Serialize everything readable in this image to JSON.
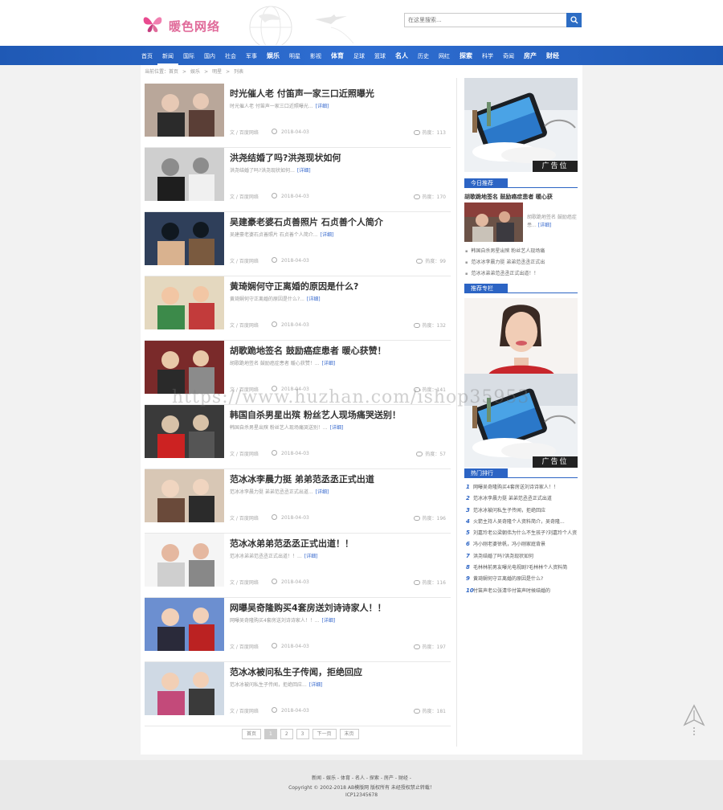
{
  "header": {
    "brand": "暖色网络",
    "search_placeholder": "在这里搜索..."
  },
  "nav": [
    {
      "label": "首页",
      "active": false,
      "big": false
    },
    {
      "label": "新闻",
      "active": true,
      "big": false
    },
    {
      "label": "国际",
      "active": false,
      "big": false
    },
    {
      "label": "国内",
      "active": false,
      "big": false
    },
    {
      "label": "社会",
      "active": false,
      "big": false
    },
    {
      "label": "军事",
      "active": false,
      "big": false
    },
    {
      "label": "娱乐",
      "active": false,
      "big": true
    },
    {
      "label": "明星",
      "active": false,
      "big": false
    },
    {
      "label": "影视",
      "active": false,
      "big": false
    },
    {
      "label": "体育",
      "active": false,
      "big": true
    },
    {
      "label": "足球",
      "active": false,
      "big": false
    },
    {
      "label": "篮球",
      "active": false,
      "big": false
    },
    {
      "label": "名人",
      "active": false,
      "big": true
    },
    {
      "label": "历史",
      "active": false,
      "big": false
    },
    {
      "label": "网红",
      "active": false,
      "big": false
    },
    {
      "label": "探索",
      "active": false,
      "big": true
    },
    {
      "label": "科学",
      "active": false,
      "big": false
    },
    {
      "label": "奇闻",
      "active": false,
      "big": false
    },
    {
      "label": "房产",
      "active": false,
      "big": true
    },
    {
      "label": "财经",
      "active": false,
      "big": true
    }
  ],
  "breadcrumb": {
    "prefix": "当前位置：首页",
    "items": [
      "娱乐",
      "明星",
      "列表"
    ]
  },
  "articles": [
    {
      "title": "时光催人老 付笛声一家三口近照曝光",
      "summary": "时光催人老 付笛声一家三口近照曝光...",
      "more": "[详细]",
      "source": "文 / 百度网络",
      "date": "2018-04-03",
      "hot": "热度：113"
    },
    {
      "title": "洪尧结婚了吗?洪尧现状如何",
      "summary": "洪尧结婚了吗?洪尧现状如何...",
      "more": "[详细]",
      "source": "文 / 百度网络",
      "date": "2018-04-03",
      "hot": "热度：170"
    },
    {
      "title": "吴建豪老婆石贞善照片 石贞善个人简介",
      "summary": "吴建豪老婆石贞善照片 石贞善个人简介...",
      "more": "[详细]",
      "source": "文 / 百度网络",
      "date": "2018-04-03",
      "hot": "热度：99"
    },
    {
      "title": "黄琦娴何守正离婚的原因是什么?",
      "summary": "黄琦娴何守正离婚的原因是什么?...",
      "more": "[详细]",
      "source": "文 / 百度网络",
      "date": "2018-04-03",
      "hot": "热度：132"
    },
    {
      "title": "胡歌跪地签名 鼓励癌症患者 暖心获赞！",
      "summary": "胡歌跪地签名 鼓励癌症患者 暖心获赞！...",
      "more": "[详细]",
      "source": "文 / 百度网络",
      "date": "2018-04-03",
      "hot": "热度：141"
    },
    {
      "title": "韩国自杀男星出殡 粉丝艺人现场痛哭送别！",
      "summary": "韩国自杀男星出殡 粉丝艺人现场痛哭送别！...",
      "more": "[详细]",
      "source": "文 / 百度网络",
      "date": "2018-04-03",
      "hot": "热度：57"
    },
    {
      "title": "范冰冰李晨力挺 弟弟范丞丞正式出道",
      "summary": "范冰冰李晨力挺 弟弟范丞丞正式出道...",
      "more": "[详细]",
      "source": "文 / 百度网络",
      "date": "2018-04-03",
      "hot": "热度：196"
    },
    {
      "title": "范冰冰弟弟范丞丞正式出道！！",
      "summary": "范冰冰弟弟范丞丞正式出道！！...",
      "more": "[详细]",
      "source": "文 / 百度网络",
      "date": "2018-04-03",
      "hot": "热度：116"
    },
    {
      "title": "网曝吴奇隆购买4套房送刘诗诗家人！！",
      "summary": "网曝吴奇隆购买4套房送刘诗诗家人！！...",
      "more": "[详细]",
      "source": "文 / 百度网络",
      "date": "2018-04-03",
      "hot": "热度：197"
    },
    {
      "title": "范冰冰被问私生子传闻，拒绝回应",
      "summary": "范冰冰被问私生子传闻，拒绝回应...",
      "more": "[详细]",
      "source": "文 / 百度网络",
      "date": "2018-04-03",
      "hot": "热度：181"
    }
  ],
  "pager": [
    "首页",
    "1",
    "2",
    "3",
    "下一页",
    "末页"
  ],
  "sidebar": {
    "ad_label": "广告位",
    "today_head": "今日推荐",
    "today_title": "胡歌跪地签名 鼓励癌症患者 暖心获",
    "today_summary": "胡歌跪地签名 鼓励癌症患...",
    "today_more": "[详细]",
    "today_list": [
      "韩国自杀男星出殡 粉丝艺人现场痛",
      "范冰冰李晨力挺 弟弟范丞丞正式出",
      "范冰冰弟弟范丞丞正式出道！！"
    ],
    "rec_head": "推荐专栏",
    "hot_head": "热门排行",
    "hot_list": [
      "网曝吴奇隆购买4套房送刘诗诗家人！！",
      "范冰冰李晨力挺 弟弟范丞丞正式出道",
      "范冰冰被问私生子传闻，拒绝回应",
      "火箭主持人吴奇隆个人资料简介，吴奇隆...",
      "刘嘉玲老公梁朝伟为什么不生孩子?刘嘉玲个人资",
      "冯小刚老婆徐帆，冯小刚家庭背景",
      "洪尧结婚了吗?洪尧现状如何",
      "毛林林前男友曝光电视剧?毛林林个人资料简",
      "黄琦娴何守正离婚的原因是什么?",
      "付笛声老公张清华付笛声时候结婚的"
    ]
  },
  "watermark": "https://www.huzhan.com/ishop35953",
  "footer": {
    "links": "新闻 - 娱乐 - 体育 - 名人 - 探索 - 房产 - 财经 -",
    "copyright": "Copyright © 2002-2018 AB模版网 版权所有 未经授权禁止转载！",
    "icp": "ICP12345678"
  }
}
